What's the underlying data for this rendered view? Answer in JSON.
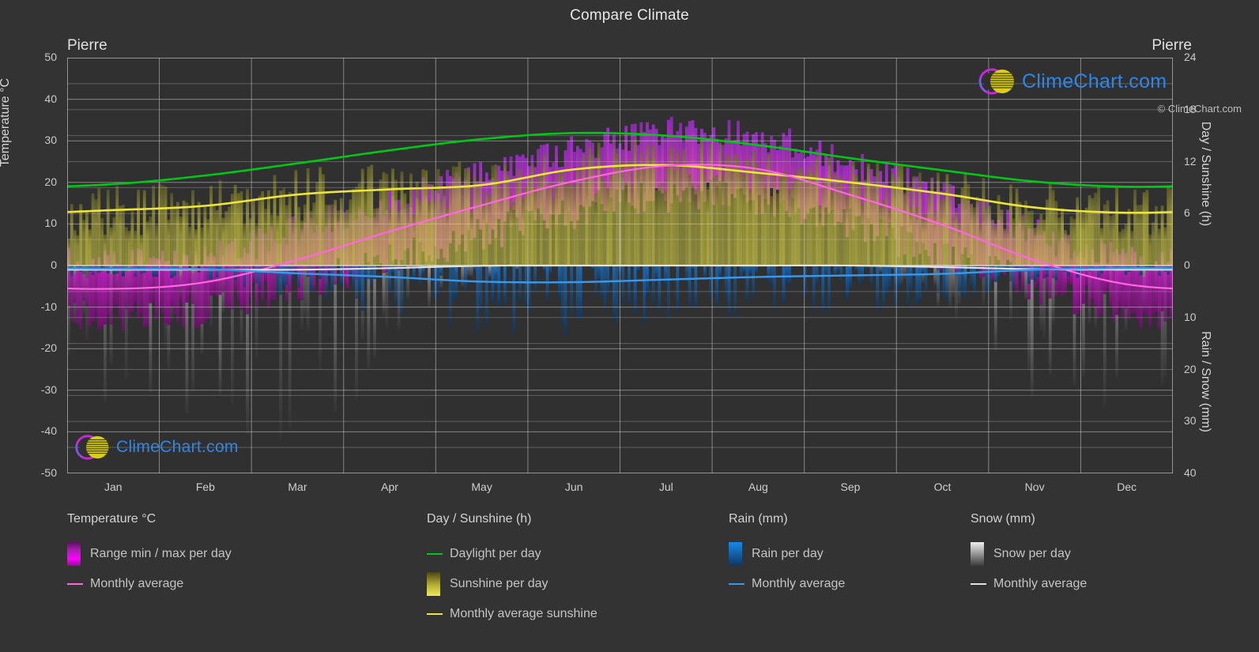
{
  "header": {
    "title": "Compare Climate",
    "city_left": "Pierre",
    "city_right": "Pierre"
  },
  "axes": {
    "y_left_label": "Temperature °C",
    "y_left_ticks": [
      "50",
      "40",
      "30",
      "20",
      "10",
      "0",
      "-10",
      "-20",
      "-30",
      "-40",
      "-50"
    ],
    "y_right_top_label": "Day / Sunshine (h)",
    "y_right_top_ticks": [
      "24",
      "18",
      "12",
      "6",
      "0"
    ],
    "y_right_bottom_label": "Rain / Snow (mm)",
    "y_right_bottom_ticks": [
      "0",
      "10",
      "20",
      "30",
      "40"
    ],
    "x_ticks": [
      "Jan",
      "Feb",
      "Mar",
      "Apr",
      "May",
      "Jun",
      "Jul",
      "Aug",
      "Sep",
      "Oct",
      "Nov",
      "Dec"
    ]
  },
  "legend": {
    "groups": [
      {
        "title": "Temperature °C",
        "items": [
          {
            "label": "Range min / max per day",
            "marker": "gradient-swatch",
            "color": "#ff00ff"
          },
          {
            "label": "Monthly average",
            "marker": "line",
            "color": "#ff66e0"
          }
        ]
      },
      {
        "title": "Day / Sunshine (h)",
        "items": [
          {
            "label": "Daylight per day",
            "marker": "line",
            "color": "#00c814"
          },
          {
            "label": "Sunshine per day",
            "marker": "gradient-swatch",
            "color": "#ede542"
          },
          {
            "label": "Monthly average sunshine",
            "marker": "line",
            "color": "#ece63c"
          }
        ]
      },
      {
        "title": "Rain (mm)",
        "items": [
          {
            "label": "Rain per day",
            "marker": "gradient-swatch",
            "color": "#1787e8"
          },
          {
            "label": "Monthly average",
            "marker": "line",
            "color": "#3b9ae8"
          }
        ]
      },
      {
        "title": "Snow (mm)",
        "items": [
          {
            "label": "Snow per day",
            "marker": "gradient-swatch",
            "color": "#e8e8e8"
          },
          {
            "label": "Monthly average",
            "marker": "line",
            "color": "#e2e2e2"
          }
        ]
      }
    ],
    "copyright": "© ClimeChart.com"
  },
  "watermark": {
    "text": "ClimeChart.com"
  },
  "chart_data": {
    "type": "line",
    "title": "Compare Climate",
    "subtitle": "Pierre",
    "xlabel": "",
    "ylabel": "Temperature °C",
    "ylim": [
      -50,
      50
    ],
    "y2_sunshine_lim": [
      0,
      24
    ],
    "y2_precip_lim": [
      0,
      40
    ],
    "grid": true,
    "legend_position": "bottom",
    "x": [
      "Jan",
      "Feb",
      "Mar",
      "Apr",
      "May",
      "Jun",
      "Jul",
      "Aug",
      "Sep",
      "Oct",
      "Nov",
      "Dec"
    ],
    "series": [
      {
        "name": "Daylight per day",
        "units": "h",
        "axis": "right-sunshine",
        "color": "#00c814",
        "values": [
          9.4,
          10.4,
          11.8,
          13.3,
          14.6,
          15.3,
          15.0,
          13.9,
          12.4,
          11.0,
          9.7,
          9.1
        ]
      },
      {
        "name": "Monthly average sunshine",
        "units": "h",
        "axis": "right-sunshine",
        "color": "#ece63c",
        "values": [
          6.4,
          6.9,
          8.2,
          8.8,
          9.3,
          11.1,
          11.6,
          10.7,
          9.6,
          8.3,
          6.7,
          6.1
        ]
      },
      {
        "name": "Monthly average temperature",
        "units": "°C",
        "axis": "left-temperature",
        "color": "#ff66e0",
        "values": [
          -5.6,
          -4.0,
          1.4,
          8.2,
          14.5,
          20.3,
          24.0,
          23.2,
          17.0,
          9.8,
          1.3,
          -4.5
        ]
      },
      {
        "name": "Rain monthly average",
        "units": "mm",
        "axis": "right-precip",
        "color": "#3b9ae8",
        "values": [
          0.6,
          0.7,
          1.5,
          2.2,
          3.1,
          3.2,
          2.7,
          2.2,
          1.9,
          1.6,
          0.8,
          0.5
        ]
      },
      {
        "name": "Snow monthly average",
        "units": "mm",
        "axis": "right-precip",
        "color": "#e2e2e2",
        "values": [
          0.8,
          0.8,
          0.8,
          0.5,
          0.05,
          0.0,
          0.0,
          0.0,
          0.0,
          0.3,
          0.7,
          0.8
        ]
      },
      {
        "name": "Temperature range max per day",
        "units": "°C",
        "axis": "left-temperature",
        "color": "#ff00ff",
        "values": [
          0.5,
          2.2,
          8.6,
          16.2,
          22.0,
          28.0,
          32.0,
          31.0,
          24.5,
          16.8,
          7.6,
          1.4
        ]
      },
      {
        "name": "Temperature range min per day",
        "units": "°C",
        "axis": "left-temperature",
        "color": "#ff00ff",
        "values": [
          -12.0,
          -10.5,
          -4.5,
          1.4,
          7.5,
          13.0,
          16.5,
          15.4,
          9.5,
          2.4,
          -5.0,
          -10.8
        ]
      },
      {
        "name": "Rain per day",
        "units": "mm",
        "axis": "right-precip",
        "color": "#1787e8",
        "values": [
          1.5,
          2.0,
          4.5,
          6.5,
          9.0,
          9.5,
          8.0,
          6.5,
          6.0,
          5.0,
          2.5,
          1.5
        ]
      },
      {
        "name": "Snow per day",
        "units": "mm",
        "axis": "right-precip",
        "color": "#e8e8e8",
        "values": [
          18.0,
          20.0,
          22.0,
          12.0,
          2.0,
          0.0,
          0.0,
          0.0,
          0.0,
          6.0,
          16.0,
          19.0
        ]
      }
    ]
  }
}
